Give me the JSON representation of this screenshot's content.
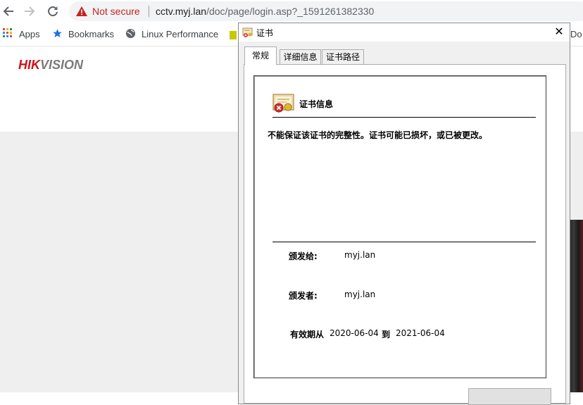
{
  "browser": {
    "not_secure": "Not secure",
    "url_host": "cctv.myj.lan",
    "url_path": "/doc/page/login.asp?_1591261382330",
    "bookmarks": [
      {
        "label": "Apps"
      },
      {
        "label": "Bookmarks"
      },
      {
        "label": "Linux Performance"
      },
      {
        "label": "Do"
      }
    ]
  },
  "page": {
    "logo_part1": "HIK",
    "logo_part2": "VISION"
  },
  "dialog": {
    "title": "证书",
    "close_glyph": "✕",
    "tabs": [
      {
        "label": "常规"
      },
      {
        "label": "详细信息"
      },
      {
        "label": "证书路径"
      }
    ],
    "info_title": "证书信息",
    "warning": "不能保证该证书的完整性。证书可能已损坏，或已被更改。",
    "issued_to_label": "颁发给:",
    "issued_to_value": "myj.lan",
    "issued_by_label": "颁发者:",
    "issued_by_value": "myj.lan",
    "validity_label": "有效期从",
    "valid_from": "2020-06-04",
    "validity_to": "到",
    "valid_to": "2021-06-04"
  },
  "colors": {
    "warning_red": "#c5221f",
    "logo_red": "#d0111b",
    "logo_gray": "#7b7b7b",
    "bookmark_star_blue": "#1a73e8"
  }
}
